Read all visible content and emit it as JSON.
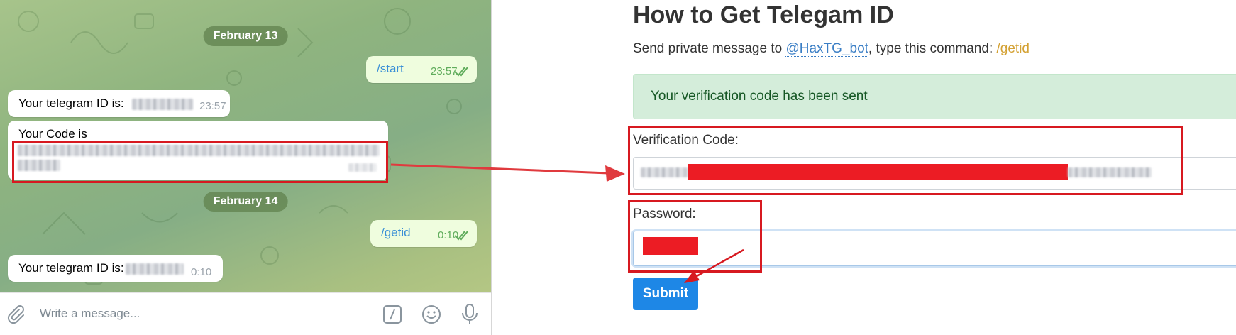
{
  "telegram": {
    "dates": [
      "February 13",
      "February 14"
    ],
    "messages": [
      {
        "dir": "out",
        "text": "/start",
        "time": "23:57"
      },
      {
        "dir": "in",
        "text": "Your telegram ID is:",
        "time": "23:57"
      },
      {
        "dir": "in",
        "text": "Your Code is",
        "time": ""
      },
      {
        "dir": "out",
        "text": "/getid",
        "time": "0:10"
      },
      {
        "dir": "in",
        "text": "Your telegram ID is:",
        "time": "0:10"
      }
    ],
    "composer_placeholder": "Write a message...",
    "icons": [
      "paperclip-icon",
      "bot-command-icon",
      "emoji-icon",
      "microphone-icon"
    ]
  },
  "form": {
    "title": "How to Get Telegam ID",
    "instruction_prefix": "Send private message to ",
    "bot_handle": "@HaxTG_bot",
    "instruction_middle": ", type this command: ",
    "command": "/getid",
    "alert": "Your verification code has been sent",
    "verification_label": "Verification Code:",
    "password_label": "Password:",
    "submit_label": "Submit"
  },
  "colors": {
    "annotation_red": "#d71920",
    "alert_green": "#155724",
    "submit_blue": "#1e87e6",
    "link_blue": "#3a7ec5",
    "command_gold": "#d4a235"
  }
}
